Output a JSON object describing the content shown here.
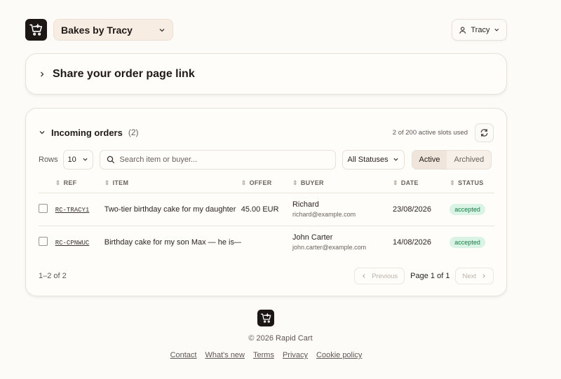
{
  "header": {
    "shop_name": "Bakes by Tracy",
    "user_name": "Tracy"
  },
  "share": {
    "title": "Share your order page link"
  },
  "orders": {
    "title": "Incoming orders",
    "count": "(2)",
    "slots_text": "2 of 200 active slots used",
    "rows_label": "Rows",
    "rows_value": "10",
    "search_placeholder": "Search item or buyer...",
    "status_filter": "All Statuses",
    "tabs": [
      "Active",
      "Archived"
    ],
    "active_tab": "Active",
    "columns": [
      "REF",
      "ITEM",
      "OFFER",
      "BUYER",
      "DATE",
      "STATUS"
    ],
    "rows": [
      {
        "ref": "RC-TRACY1",
        "item": "Two-tier birthday cake for my daughter",
        "offer": "45.00 EUR",
        "buyer_name": "Richard",
        "buyer_email": "richard@example.com",
        "date": "23/08/2026",
        "status": "accepted"
      },
      {
        "ref": "RC-CPNWUC",
        "item": "Birthday cake for my son Max — he is—",
        "offer": "",
        "buyer_name": "John Carter",
        "buyer_email": "john.carter@example.com",
        "date": "14/08/2026",
        "status": "accepted"
      }
    ],
    "range_text": "1–2 of 2",
    "prev_label": "Previous",
    "page_text": "Page 1 of 1",
    "next_label": "Next"
  },
  "footer": {
    "copyright": "© 2026 Rapid Cart",
    "links": [
      "Contact",
      "What's new",
      "Terms",
      "Privacy",
      "Cookie policy"
    ]
  },
  "colors": {
    "accent_badge_bg": "#d9f4e4",
    "accent_badge_text": "#177a45",
    "logo_bg": "#1c1714"
  }
}
